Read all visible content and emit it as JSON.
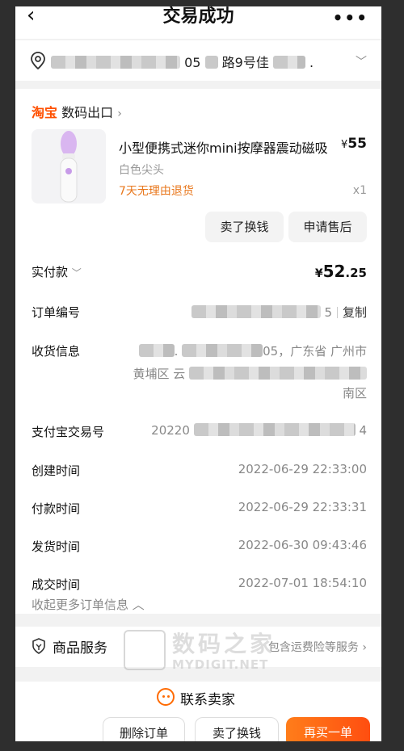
{
  "header": {
    "title": "交易成功",
    "back_icon": "chevron-left-icon",
    "more_icon": "more-dots-icon"
  },
  "address": {
    "visible_text_1": "05",
    "visible_text_2": "路9号佳",
    "visible_text_3": "."
  },
  "shop": {
    "logo": "淘宝",
    "name": "数码出口"
  },
  "product": {
    "name": "小型便携式迷你mini按摩器震动磁吸",
    "price_symbol": "¥",
    "price": "55",
    "sku": "白色尖头",
    "return_policy": "7天无理由退货",
    "quantity": "x1"
  },
  "item_actions": {
    "sell": "卖了换钱",
    "after_sale": "申请售后"
  },
  "payment": {
    "label": "实付款",
    "symbol": "¥",
    "integer": "52",
    "decimal": ".25"
  },
  "order_no": {
    "label": "订单编号",
    "tail": "5",
    "copy": "复制"
  },
  "receiver": {
    "label": "收货信息",
    "line1_mid": ".",
    "line1_tail": "05，广东省 广州市",
    "line2_head": "黄埔区 云",
    "line3": "南区"
  },
  "alipay": {
    "label": "支付宝交易号",
    "head": "20220",
    "tail": "4"
  },
  "times": {
    "created": {
      "label": "创建时间",
      "value": "2022-06-29 22:33:00"
    },
    "paid": {
      "label": "付款时间",
      "value": "2022-06-29 22:33:31"
    },
    "shipped": {
      "label": "发货时间",
      "value": "2022-06-30 09:43:46"
    },
    "completed": {
      "label": "成交时间",
      "value": "2022-07-01 18:54:10"
    }
  },
  "collapse_label": "收起更多订单信息 ︿",
  "service": {
    "title": "商品服务",
    "detail": "包含运费险等服务 ›"
  },
  "watermark": {
    "cn": "数码之家",
    "en": "MYDIGIT.NET"
  },
  "contact": {
    "label": "联系卖家"
  },
  "bottom_actions": {
    "delete": "删除订单",
    "sell": "卖了换钱",
    "rebuy": "再买一单"
  },
  "colors": {
    "accent": "#ff5000",
    "return_text": "#e8771c",
    "buy_button": "#ff5a12"
  }
}
